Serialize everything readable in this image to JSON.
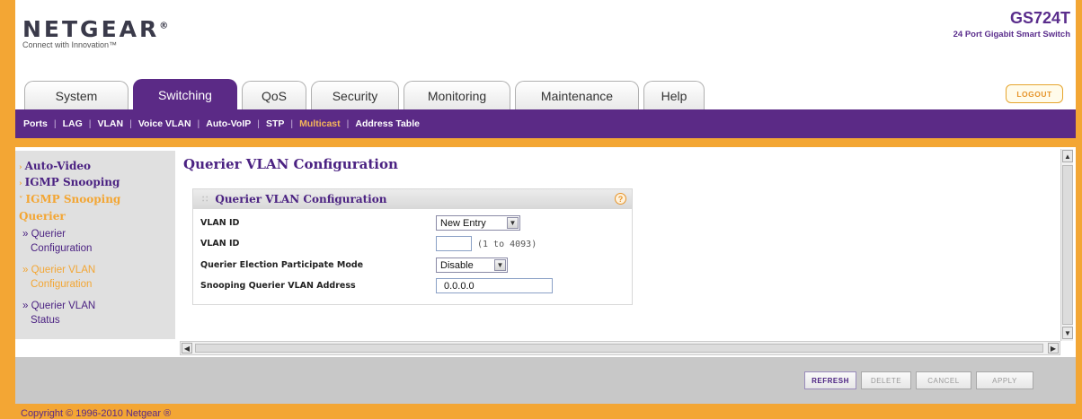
{
  "brand": {
    "logo": "NETGEAR",
    "logo_mark": "®",
    "tagline": "Connect with Innovation™"
  },
  "model": {
    "name": "GS724T",
    "description": "24 Port Gigabit Smart Switch"
  },
  "tabs": [
    {
      "label": "System",
      "active": false
    },
    {
      "label": "Switching",
      "active": true
    },
    {
      "label": "QoS",
      "active": false
    },
    {
      "label": "Security",
      "active": false
    },
    {
      "label": "Monitoring",
      "active": false
    },
    {
      "label": "Maintenance",
      "active": false
    },
    {
      "label": "Help",
      "active": false
    }
  ],
  "logout_label": "LOGOUT",
  "subnav": [
    {
      "label": "Ports"
    },
    {
      "label": "LAG"
    },
    {
      "label": "VLAN"
    },
    {
      "label": "Voice VLAN"
    },
    {
      "label": "Auto-VoIP"
    },
    {
      "label": "STP"
    },
    {
      "label": "Multicast",
      "active": true
    },
    {
      "label": "Address Table"
    }
  ],
  "leftnav": {
    "auto_video": "Auto-Video",
    "igmp_snooping": "IGMP Snooping",
    "igmp_snooping_querier_1": "IGMP Snooping",
    "igmp_snooping_querier_2": "Querier",
    "querier_config_1": "» Querier",
    "querier_config_2": "Configuration",
    "querier_vlan_config_1": "» Querier VLAN",
    "querier_vlan_config_2": "Configuration",
    "querier_vlan_status_1": "» Querier VLAN",
    "querier_vlan_status_2": "Status"
  },
  "page_title": "Querier VLAN Configuration",
  "panel": {
    "title": "Querier VLAN Configuration",
    "help": "?",
    "fields": {
      "vlan_id_select_label": "VLAN ID",
      "vlan_id_select_value": "New Entry",
      "vlan_id_input_label": "VLAN ID",
      "vlan_id_input_value": "",
      "vlan_id_hint": "(1 to 4093)",
      "participate_label": "Querier Election Participate Mode",
      "participate_value": "Disable",
      "address_label": "Snooping Querier VLAN Address",
      "address_value": "0.0.0.0"
    }
  },
  "actions": {
    "refresh": "REFRESH",
    "delete": "DELETE",
    "cancel": "CANCEL",
    "apply": "APPLY"
  },
  "footer": "Copyright © 1996-2010 Netgear ®"
}
